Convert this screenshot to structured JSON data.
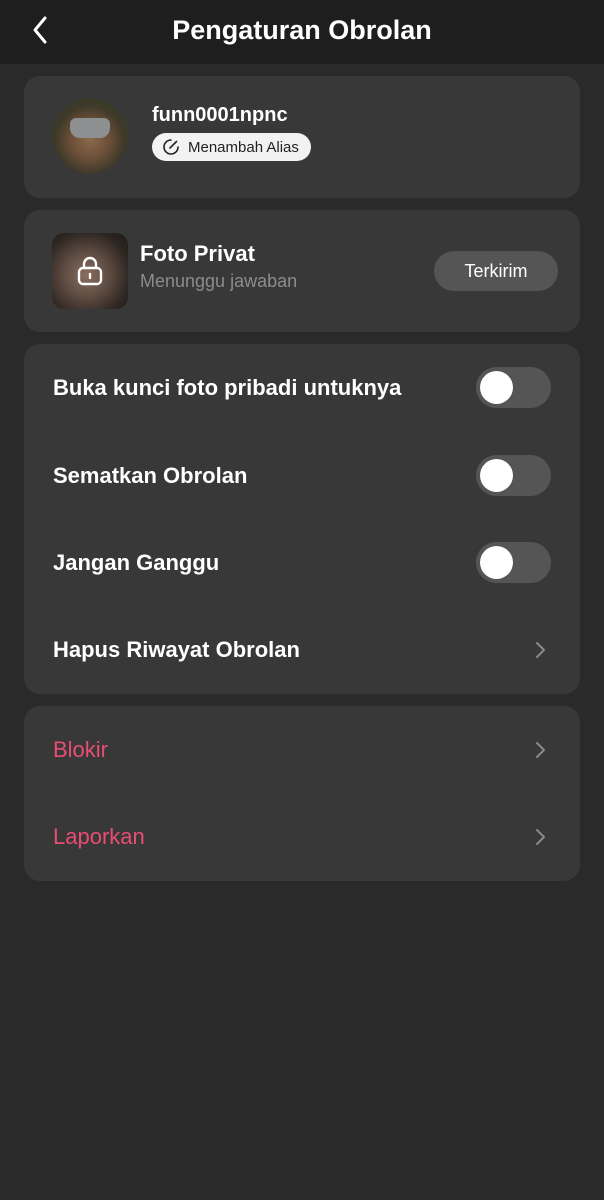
{
  "header": {
    "title": "Pengaturan Obrolan",
    "back_icon": "chevron-left-icon"
  },
  "profile": {
    "username": "funn0001npnc",
    "alias_button_label": "Menambah Alias",
    "alias_icon": "edit-icon"
  },
  "private_photo": {
    "title": "Foto Privat",
    "status": "Menunggu jawaban",
    "button_label": "Terkirim",
    "icon": "lock-icon"
  },
  "settings": {
    "items": [
      {
        "label": "Buka kunci foto pribadi untuknya",
        "type": "toggle",
        "enabled": false
      },
      {
        "label": "Sematkan Obrolan",
        "type": "toggle",
        "enabled": false
      },
      {
        "label": "Jangan Ganggu",
        "type": "toggle",
        "enabled": false
      },
      {
        "label": "Hapus Riwayat Obrolan",
        "type": "link",
        "icon": "chevron-right-icon"
      }
    ]
  },
  "danger": {
    "items": [
      {
        "label": "Blokir",
        "icon": "chevron-right-icon"
      },
      {
        "label": "Laporkan",
        "icon": "chevron-right-icon"
      }
    ]
  },
  "colors": {
    "background": "#2a2a2a",
    "header_bg": "#1e1e1e",
    "card_bg": "#383838",
    "toggle_off": "#555555",
    "danger_text": "#e84d74",
    "secondary_text": "#8c8c8c"
  }
}
